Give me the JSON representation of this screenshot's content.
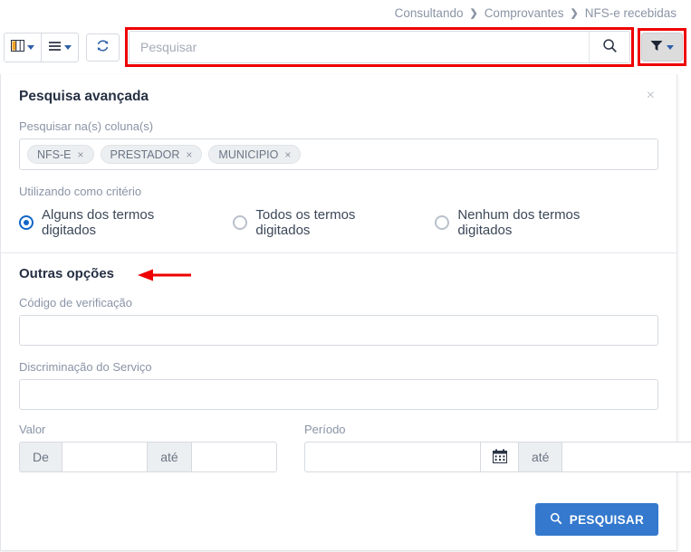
{
  "breadcrumb": {
    "items": [
      "Consultando",
      "Comprovantes",
      "NFS-e recebidas"
    ],
    "separator": "❯"
  },
  "toolbar": {
    "columns_button": "columns-icon",
    "list_button": "list-icon",
    "refresh_button": "refresh-icon",
    "filter_button": "filter-icon"
  },
  "search": {
    "placeholder": "Pesquisar",
    "value": "",
    "submit_icon": "search-icon"
  },
  "panel": {
    "title": "Pesquisa avançada",
    "close_label": "×",
    "columns_label": "Pesquisar na(s) coluna(s)",
    "chips": [
      {
        "label": "NFS-E",
        "remove": "×"
      },
      {
        "label": "PRESTADOR",
        "remove": "×"
      },
      {
        "label": "MUNICIPIO",
        "remove": "×"
      }
    ],
    "criteria_label": "Utilizando como critério",
    "criteria_options": [
      {
        "label": "Alguns dos termos digitados",
        "selected": true
      },
      {
        "label": "Todos os termos digitados",
        "selected": false
      },
      {
        "label": "Nenhum dos termos digitados",
        "selected": false
      }
    ]
  },
  "other_options": {
    "title": "Outras opções",
    "codigo_label": "Código de verificação",
    "codigo_value": "",
    "discriminacao_label": "Discriminação do Serviço",
    "discriminacao_value": "",
    "valor_label": "Valor",
    "valor_from_addon": "De",
    "valor_from_value": "",
    "valor_to_addon": "até",
    "valor_to_value": "",
    "periodo_label": "Período",
    "periodo_from_value": "",
    "periodo_to_addon": "até",
    "periodo_to_value": "",
    "calendar_icon": "calendar-icon"
  },
  "submit": {
    "label": "PESQUISAR",
    "icon": "search-icon"
  },
  "colors": {
    "accent_blue": "#3479cd",
    "radio_blue": "#1266c9",
    "annotation_red": "#ee0000",
    "muted_text": "#8a94a6",
    "border": "#d6dae0"
  }
}
